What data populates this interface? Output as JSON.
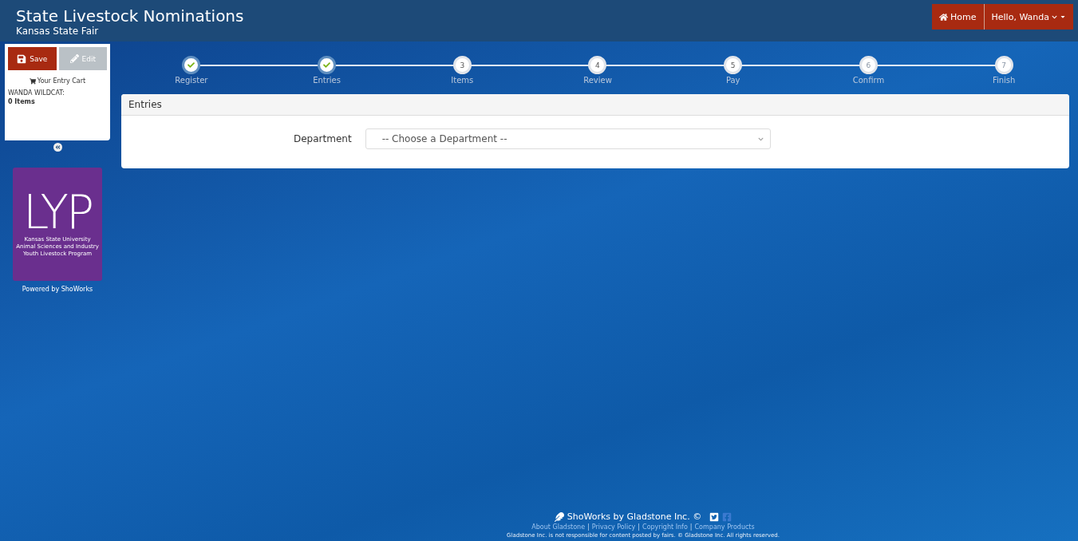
{
  "header": {
    "title": "State Livestock Nominations",
    "subtitle": "Kansas State Fair",
    "home": "Home",
    "user_menu": "Hello, Wanda"
  },
  "sidebar": {
    "save": "Save",
    "edit": "Edit",
    "edit_disabled": true,
    "cart_title": "Your Entry Cart",
    "cart_owner": "WANDA WILDCAT:",
    "cart_count": "0 Items",
    "logo_letters": "LYP",
    "logo_lines": [
      "Kansas State University",
      "Animal Sciences and Industry",
      "Youth Livestock Program"
    ],
    "powered_by": "Powered by ShoWorks"
  },
  "steps": [
    {
      "label": "Register",
      "done": true,
      "disabled": false
    },
    {
      "label": "Entries",
      "done": true,
      "disabled": false
    },
    {
      "number": "3",
      "label": "Items",
      "done": false,
      "disabled": false
    },
    {
      "number": "4",
      "label": "Review",
      "done": false,
      "disabled": false
    },
    {
      "number": "5",
      "label": "Pay",
      "done": false,
      "disabled": false
    },
    {
      "number": "6",
      "label": "Confirm",
      "done": false,
      "disabled": true
    },
    {
      "number": "7",
      "label": "Finish",
      "done": false,
      "disabled": true
    }
  ],
  "panel": {
    "title": "Entries",
    "field_label": "Department",
    "select_value": "-- Choose a Department --"
  },
  "footer": {
    "brand": "ShoWorks by Gladstone Inc. ©",
    "link_separator": "|",
    "links": [
      "About Gladstone",
      "Privacy Policy",
      "Copyright Info",
      "Company Products"
    ],
    "disclaimer": "Gladstone Inc. is not responsible for content posted by fairs. © Gladstone Inc. All rights reserved."
  }
}
